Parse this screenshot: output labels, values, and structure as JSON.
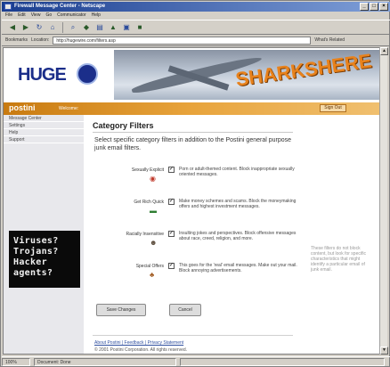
{
  "window": {
    "title": "Firewall Message Center - Netscape"
  },
  "menubar": [
    "File",
    "Edit",
    "View",
    "Go",
    "Communicator",
    "Help"
  ],
  "toolbar": {
    "bookmarks_label": "Bookmarks",
    "location_label": "Location:",
    "related_label": "What's Related"
  },
  "address": {
    "url": "http://hugewire.com/filters.asp"
  },
  "banner": {
    "logo": "HUGE",
    "headline_top": "SHARKS",
    "headline_bottom": "HERE"
  },
  "nav": {
    "brand": "postini",
    "welcome": "Welcome:",
    "signout": "Sign Out"
  },
  "sidebar": {
    "items": [
      "Message Center",
      "Settings",
      "Help",
      "Support"
    ]
  },
  "terminal": {
    "lines": [
      "Viruses?",
      "Trojans?",
      "Hacker",
      "agents?"
    ]
  },
  "main": {
    "heading": "Category Filters",
    "intro": "Select specific category filters in addition to the Postini general purpose junk email filters.",
    "filters": [
      {
        "name": "Sexually Explicit",
        "checked": true,
        "icon": "lips-icon",
        "desc": "Porn or adult-themed content. Block inappropriate sexually oriented messages."
      },
      {
        "name": "Get Rich Quick",
        "checked": true,
        "icon": "money-icon",
        "desc": "Make money schemes and scams. Block the moneymaking offers and highest investment messages."
      },
      {
        "name": "Racially Insensitive",
        "checked": true,
        "icon": "people-icon",
        "desc": "Insulting jokes and perspectives. Block offensive messages about race, creed, religion, and more."
      },
      {
        "name": "Special Offers",
        "checked": true,
        "icon": "gift-icon",
        "desc": "This goes for the 'real' email messages. Make out your mail. Block annoying advertisements."
      }
    ],
    "side_note": "These filters do not block content, but look for specific characteristics that might identify a particular email of junk email.",
    "buttons": {
      "save": "Save Changes",
      "cancel": "Cancel"
    },
    "footer_links": "About Postini | Feedback | Privacy Statement",
    "copyright": "© 2001 Postini Corporation. All rights reserved."
  },
  "statusbar": {
    "zoom": "100%",
    "status": "Document: Done"
  }
}
